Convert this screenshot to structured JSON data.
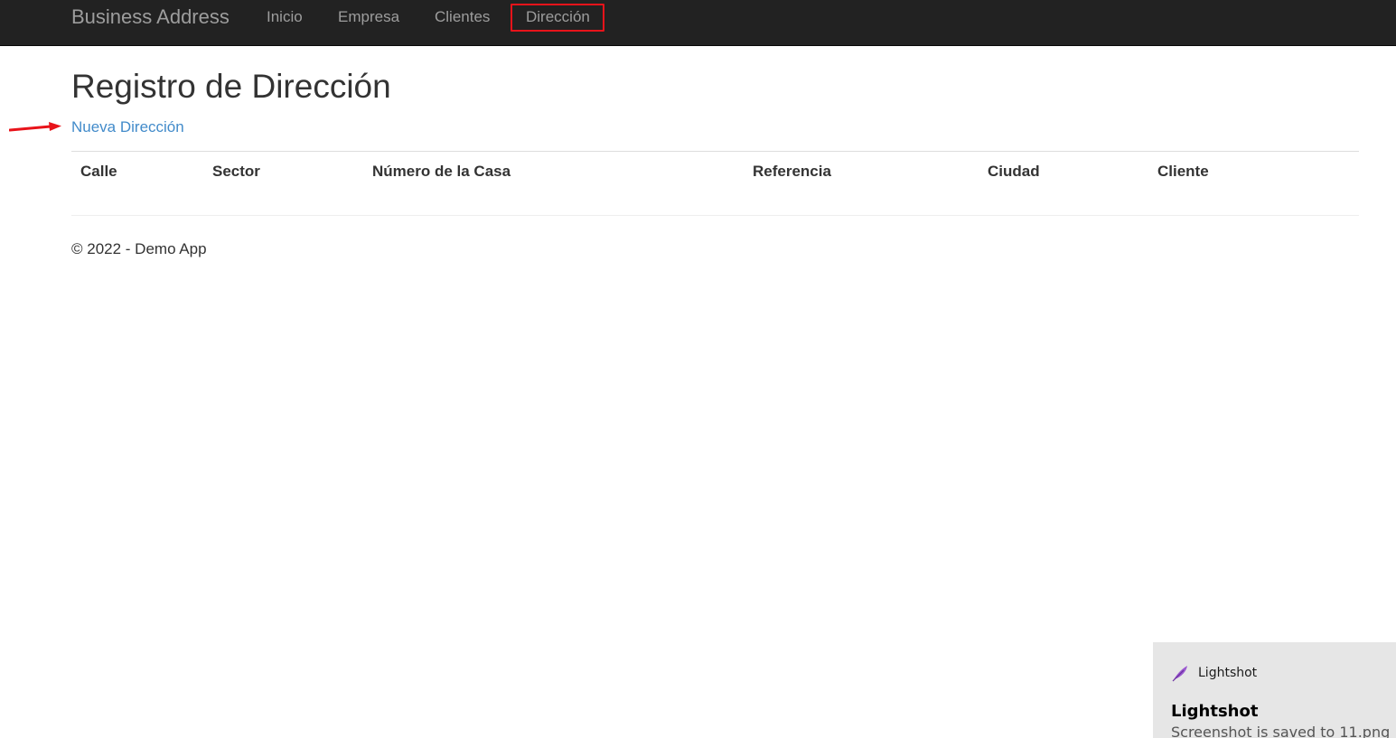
{
  "navbar": {
    "brand": "Business Address",
    "items": [
      {
        "label": "Inicio"
      },
      {
        "label": "Empresa"
      },
      {
        "label": "Clientes"
      },
      {
        "label": "Dirección",
        "highlighted": true
      }
    ]
  },
  "main": {
    "title": "Registro de Dirección",
    "new_link": "Nueva Dirección",
    "table": {
      "headers": [
        "Calle",
        "Sector",
        "Número de la Casa",
        "Referencia",
        "Ciudad",
        "Cliente"
      ],
      "rows": []
    }
  },
  "footer": {
    "text": "© 2022 - Demo App"
  },
  "notification": {
    "app": "Lightshot",
    "title": "Lightshot",
    "message": "Screenshot is saved to 11.png"
  },
  "colors": {
    "navbar_bg": "#222222",
    "nav_text": "#9d9d9d",
    "link": "#428bca",
    "highlight": "#e8131a",
    "toast_bg": "#e6e6e6"
  }
}
